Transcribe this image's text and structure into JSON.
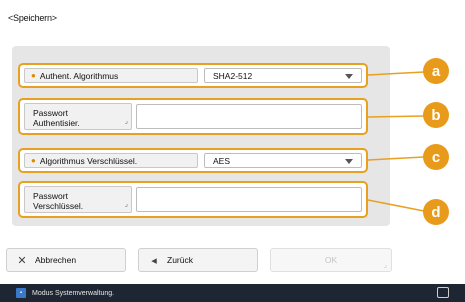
{
  "screen": {
    "title": "<Speichern>"
  },
  "fields": {
    "auth_algorithm": {
      "label": "Authent. Algorithmus",
      "value": "SHA2-512",
      "callout": "a"
    },
    "auth_password": {
      "label_line1": "Passwort",
      "label_line2": "Authentisier.",
      "value": "",
      "callout": "b"
    },
    "enc_algorithm": {
      "label": "Algorithmus Verschlüssel.",
      "value": "AES",
      "callout": "c"
    },
    "enc_password": {
      "label_line1": "Passwort",
      "label_line2": "Verschlüssel.",
      "value": "",
      "callout": "d"
    }
  },
  "buttons": {
    "cancel": {
      "label": "Abbrechen",
      "icon": "close-icon"
    },
    "back": {
      "label": "Zurück",
      "icon": "left-arrow-icon"
    },
    "ok": {
      "label": "OK"
    }
  },
  "status": {
    "text": "Modus Systemverwaltung."
  },
  "colors": {
    "accent": "#e89a1a",
    "statusbar": "#1f2633"
  }
}
